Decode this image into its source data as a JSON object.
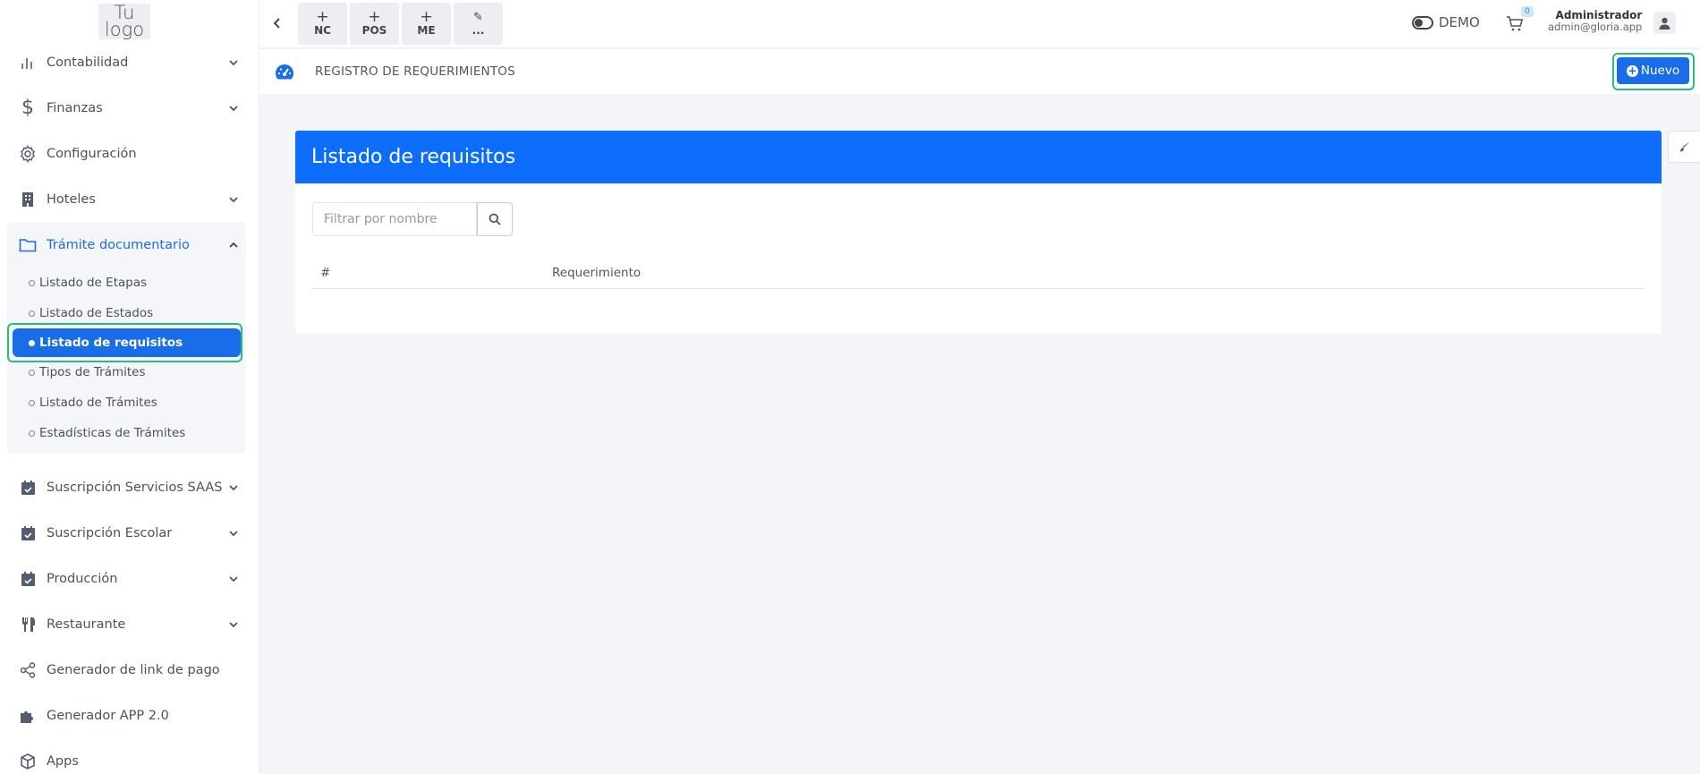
{
  "logo": {
    "line1": "Tu",
    "line2": "logo"
  },
  "sidebar": {
    "items_before": [
      {
        "label": "Contabilidad",
        "icon": "bar-chart-icon",
        "chevron": true
      },
      {
        "label": "Finanzas",
        "icon": "dollar-icon",
        "chevron": true
      },
      {
        "label": "Configuración",
        "icon": "gear-icon",
        "chevron": false
      },
      {
        "label": "Hoteles",
        "icon": "building-icon",
        "chevron": true
      }
    ],
    "open_section": {
      "label": "Trámite documentario",
      "icon": "folder-icon"
    },
    "sub_items": [
      {
        "label": "Listado de Etapas",
        "active": false
      },
      {
        "label": "Listado de Estados",
        "active": false
      },
      {
        "label": "Listado de requisitos",
        "active": true
      },
      {
        "label": "Tipos de Trámites",
        "active": false
      },
      {
        "label": "Listado de Trámites",
        "active": false
      },
      {
        "label": "Estadísticas de Trámites",
        "active": false
      }
    ],
    "items_after": [
      {
        "label": "Suscripción Servicios SAAS",
        "icon": "calendar-check-icon",
        "chevron": true
      },
      {
        "label": "Suscripción Escolar",
        "icon": "calendar-check-icon",
        "chevron": true
      },
      {
        "label": "Producción",
        "icon": "calendar-check-icon",
        "chevron": true
      },
      {
        "label": "Restaurante",
        "icon": "utensils-icon",
        "chevron": true
      },
      {
        "label": "Generador de link de pago",
        "icon": "share-icon",
        "chevron": false
      },
      {
        "label": "Generador APP 2.0",
        "icon": "puzzle-icon",
        "chevron": false
      },
      {
        "label": "Apps",
        "icon": "cube-icon",
        "chevron": false
      }
    ]
  },
  "topbar": {
    "quick_actions": [
      {
        "symbol": "+",
        "label": "NC"
      },
      {
        "symbol": "+",
        "label": "POS"
      },
      {
        "symbol": "+",
        "label": "ME"
      },
      {
        "symbol": "✎",
        "label": "..."
      }
    ],
    "demo_label": "DEMO",
    "cart_count": "0",
    "user_name": "Administrador",
    "user_email": "admin@gloria.app"
  },
  "page": {
    "title": "REGISTRO DE REQUERIMIENTOS",
    "new_button": "Nuevo"
  },
  "card": {
    "title": "Listado de requisitos",
    "filter_placeholder": "Filtrar por nombre",
    "columns": [
      "#",
      "Requerimiento"
    ]
  },
  "colors": {
    "primary": "#0d6efd",
    "highlight": "#22c07a"
  }
}
